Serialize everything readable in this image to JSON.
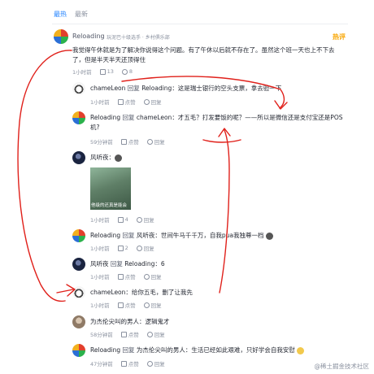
{
  "tabs": [
    {
      "label": "最热"
    },
    {
      "label": "最新"
    }
  ],
  "comments": {
    "c1": {
      "author": "Reloading",
      "badge": "玩泥巴十级选手 · 乡村俱乐部",
      "hot": "热评",
      "text1": "我觉得午休就是为了解决你说得这个问题。有了午休以后就不存在了。虽然这个班一天也上不下去",
      "text2": "了，但是半天半天还顶得住",
      "time": "1小时前",
      "likes": "13",
      "replies": "8"
    },
    "r1": {
      "author": "chameLeon",
      "reply_kw": "回复",
      "target": "Reloading",
      "text": "：这是瑞士银行的空头支票，拿去验一下",
      "time": "1小时前",
      "like": "点赞",
      "reply": "回复"
    },
    "r2": {
      "author": "Reloading",
      "reply_kw": "回复",
      "target": "chameLeon",
      "text1": "：才五毛？打发要饭的呢？——所以是微信还是支付宝还是POS",
      "text2": "机?",
      "time": "59分钟前",
      "like": "点赞",
      "reply": "回复"
    },
    "r3": {
      "author": "风听夜",
      "meme_caption": "他级的还真是能会",
      "time": "1小时前",
      "likes": "4",
      "reply": "回复"
    },
    "r4": {
      "author": "Reloading",
      "reply_kw": "回复",
      "target": "风听夜",
      "text": "：世间牛马千千万，自我pua我独尊一档",
      "time": "1小时前",
      "likes": "2",
      "reply": "回复"
    },
    "r5": {
      "author": "风听夜",
      "reply_kw": "回复",
      "target": "Reloading",
      "text": "：6",
      "time": "1小时前",
      "like": "点赞",
      "reply": "回复"
    },
    "r6": {
      "author": "chameLeon",
      "text": "：给你五毛，删了让我先",
      "time": "1小时前",
      "like": "点赞",
      "reply": "回复"
    },
    "r7": {
      "author": "为杰伦尖叫的男人",
      "text": "：逻辑鬼才",
      "time": "58分钟前",
      "like": "点赞",
      "reply": "回复"
    },
    "r8": {
      "author": "Reloading",
      "reply_kw": "回复",
      "target": "为杰伦尖叫的男人",
      "text": "：生活已经如此艰难，只好学会自我安慰",
      "time": "47分钟前",
      "like": "点赞",
      "reply": "回复"
    }
  },
  "watermark": "@稀土掘金技术社区",
  "colors": {
    "accent": "#1e80ff",
    "hot": "#f8a500",
    "annotation": "#e0201a"
  }
}
